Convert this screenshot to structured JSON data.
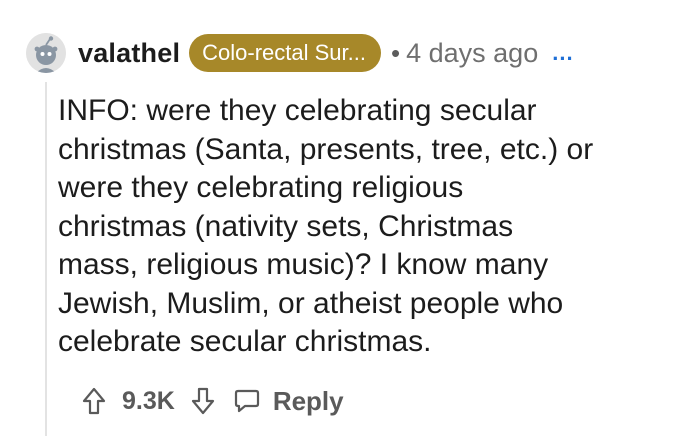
{
  "comment": {
    "username": "valathel",
    "flair": "Colo-rectal Sur...",
    "separator": "•",
    "timestamp": "4 days ago",
    "more_menu": "...",
    "body_lines": [
      "INFO: were they celebrating secular",
      "christmas (Santa, presents, tree, etc.) or",
      "were they celebrating religious",
      "christmas (nativity sets, Christmas",
      "mass, religious music)? I know many",
      "Jewish, Muslim, or atheist people who",
      "celebrate secular christmas."
    ],
    "vote_count": "9.3K",
    "reply_label": "Reply"
  },
  "colors": {
    "flair_background": "#a78829",
    "flair_text": "#ffffff",
    "more_menu": "#1f6fd6",
    "thread_line": "#e3e3e3"
  },
  "icons": {
    "avatar": "snoo-avatar-icon",
    "upvote": "upvote-arrow-icon",
    "downvote": "downvote-arrow-icon",
    "reply": "chat-bubble-icon"
  }
}
